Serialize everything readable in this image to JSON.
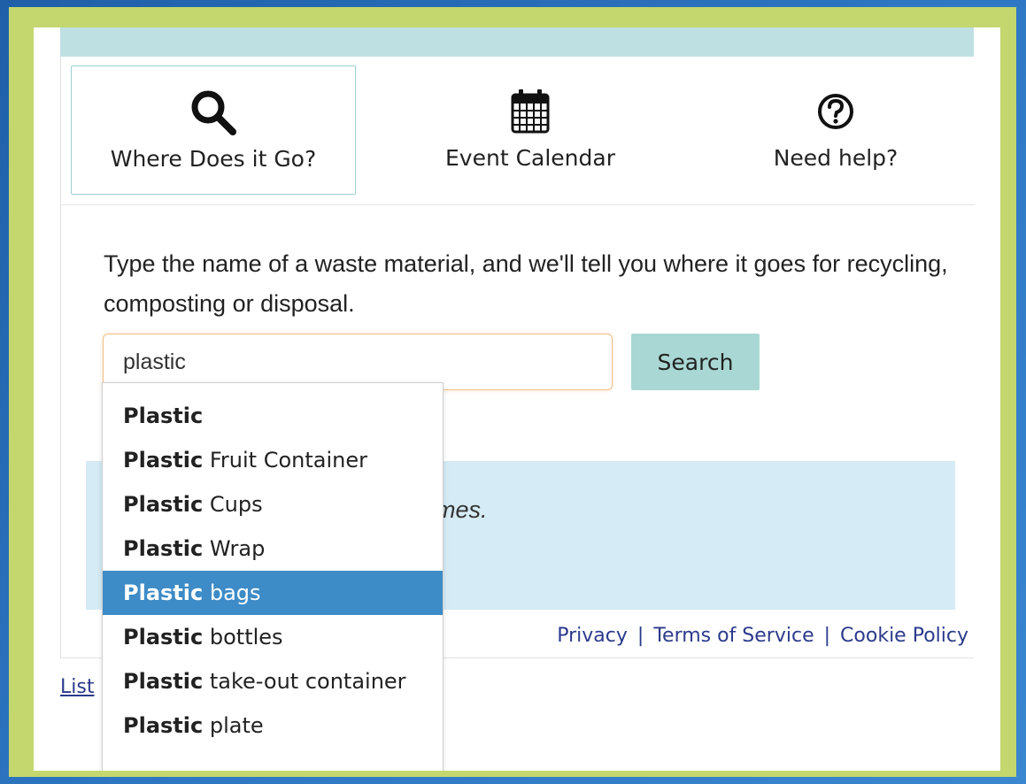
{
  "tabs": [
    {
      "label": "Where Does it Go?",
      "icon": "search-icon",
      "active": true
    },
    {
      "label": "Event Calendar",
      "icon": "calendar-icon",
      "active": false
    },
    {
      "label": "Need help?",
      "icon": "help-circle-icon",
      "active": false
    }
  ],
  "intro_text": "Type the name of a waste material, and we'll tell you where it goes for recycling, composting or disposal.",
  "search": {
    "value": "plastic",
    "button_label": "Search"
  },
  "info_box_text": "omes.",
  "suggestions": [
    {
      "bold": "Plastic",
      "rest": "",
      "highlighted": false
    },
    {
      "bold": "Plastic",
      "rest": " Fruit Container",
      "highlighted": false
    },
    {
      "bold": "Plastic",
      "rest": " Cups",
      "highlighted": false
    },
    {
      "bold": "Plastic",
      "rest": " Wrap",
      "highlighted": false
    },
    {
      "bold": "Plastic",
      "rest": " bags",
      "highlighted": true
    },
    {
      "bold": "Plastic",
      "rest": " bottles",
      "highlighted": false
    },
    {
      "bold": "Plastic",
      "rest": " take-out container",
      "highlighted": false
    },
    {
      "bold": "Plastic",
      "rest": " plate",
      "highlighted": false
    }
  ],
  "footer": {
    "privacy": "Privacy",
    "separator": "|",
    "terms": "Terms of Service",
    "cookie": "Cookie Policy"
  },
  "list_link": "List",
  "colors": {
    "frame": "#c3d76e",
    "background": "#2f78c4",
    "tab_active_border": "#9ecfd2",
    "search_button": "#a9d8d4",
    "info_box": "#d5ebf5",
    "suggestion_highlight": "#3d8bc7",
    "link": "#2b3a8c"
  }
}
